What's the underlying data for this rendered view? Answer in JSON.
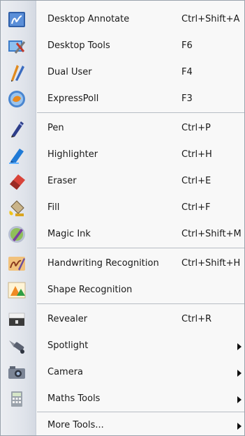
{
  "menu": {
    "items": [
      {
        "label": "Desktop Annotate",
        "shortcut": "Ctrl+Shift+A",
        "icon": "desktop-annotate-icon"
      },
      {
        "label": "Desktop Tools",
        "shortcut": "F6",
        "icon": "desktop-tools-icon"
      },
      {
        "label": "Dual User",
        "shortcut": "F4",
        "icon": "dual-user-icon"
      },
      {
        "label": "ExpressPoll",
        "shortcut": "F3",
        "icon": "expresspoll-icon"
      },
      {
        "label": "Pen",
        "shortcut": "Ctrl+P",
        "icon": "pen-icon"
      },
      {
        "label": "Highlighter",
        "shortcut": "Ctrl+H",
        "icon": "highlighter-icon"
      },
      {
        "label": "Eraser",
        "shortcut": "Ctrl+E",
        "icon": "eraser-icon"
      },
      {
        "label": "Fill",
        "shortcut": "Ctrl+F",
        "icon": "fill-icon"
      },
      {
        "label": "Magic Ink",
        "shortcut": "Ctrl+Shift+M",
        "icon": "magic-ink-icon"
      },
      {
        "label": "Handwriting Recognition",
        "shortcut": "Ctrl+Shift+H",
        "icon": "handwriting-recognition-icon"
      },
      {
        "label": "Shape Recognition",
        "shortcut": "",
        "icon": "shape-recognition-icon"
      },
      {
        "label": "Revealer",
        "shortcut": "Ctrl+R",
        "icon": "revealer-icon"
      },
      {
        "label": "Spotlight",
        "shortcut": "",
        "icon": "spotlight-icon",
        "submenu": true
      },
      {
        "label": "Camera",
        "shortcut": "",
        "icon": "camera-icon",
        "submenu": true
      },
      {
        "label": "Maths Tools",
        "shortcut": "",
        "icon": "maths-tools-icon",
        "submenu": true
      },
      {
        "label": "More Tools...",
        "shortcut": "",
        "icon": "",
        "submenu": true
      }
    ]
  },
  "colors": {
    "gutter": "#dfe3ea",
    "menu_background": "#f8f8f8",
    "separator": "#b7bcc4",
    "text": "#1a1a1a"
  }
}
